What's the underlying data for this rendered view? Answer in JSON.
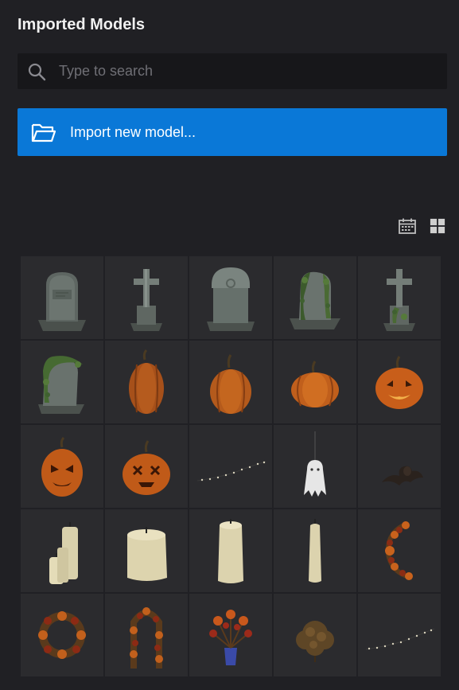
{
  "panel": {
    "title": "Imported Models"
  },
  "search": {
    "placeholder": "Type to search",
    "value": ""
  },
  "import_button": {
    "label": "Import new model..."
  },
  "colors": {
    "background": "#202024",
    "accent": "#0a78d7",
    "tile": "#2b2b2e"
  },
  "view_toggles": [
    {
      "icon": "calendar-icon"
    },
    {
      "icon": "grid-view-icon"
    }
  ],
  "models": [
    {
      "icon": "gravestone-rounded-icon"
    },
    {
      "icon": "grave-cross-icon"
    },
    {
      "icon": "gravestone-arched-icon"
    },
    {
      "icon": "gravestone-ivy-icon"
    },
    {
      "icon": "grave-cross-ivy-icon"
    },
    {
      "icon": "gravestone-ivy-arched-icon"
    },
    {
      "icon": "pumpkin-tall-icon"
    },
    {
      "icon": "pumpkin-medium-icon"
    },
    {
      "icon": "pumpkin-round-icon"
    },
    {
      "icon": "jack-o-lantern-icon"
    },
    {
      "icon": "jack-o-lantern-angry-icon"
    },
    {
      "icon": "jack-o-lantern-x-eyes-icon"
    },
    {
      "icon": "string-lights-icon"
    },
    {
      "icon": "hanging-ghost-icon"
    },
    {
      "icon": "bat-icon"
    },
    {
      "icon": "candle-cluster-icon"
    },
    {
      "icon": "candle-wide-icon"
    },
    {
      "icon": "candle-pillar-icon"
    },
    {
      "icon": "candle-thin-icon"
    },
    {
      "icon": "autumn-garland-crescent-icon"
    },
    {
      "icon": "autumn-wreath-icon"
    },
    {
      "icon": "autumn-garland-arch-icon"
    },
    {
      "icon": "flower-vase-icon"
    },
    {
      "icon": "dried-bush-icon"
    },
    {
      "icon": "string-lights-2-icon"
    }
  ]
}
